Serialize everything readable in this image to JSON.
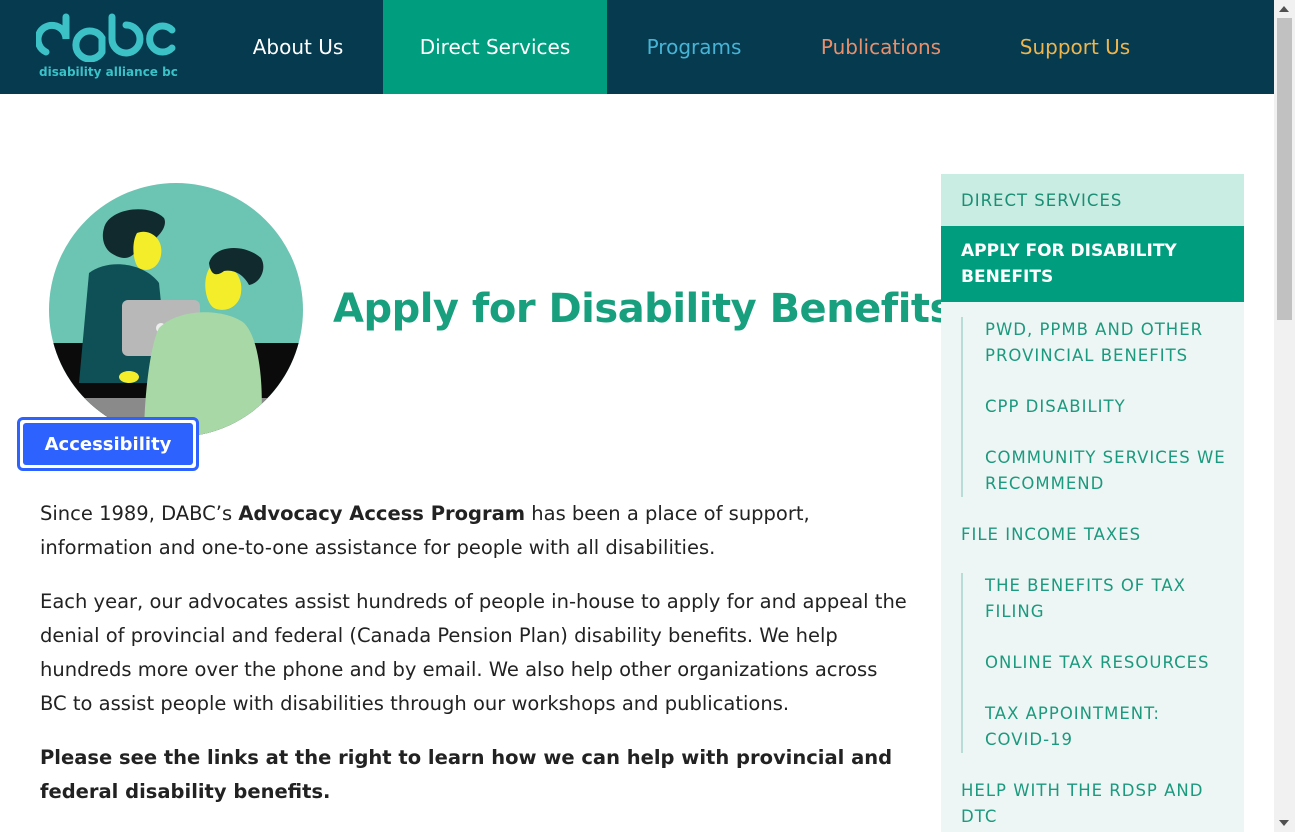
{
  "header": {
    "logo_text": "dabc",
    "logo_subtext": "disability alliance bc",
    "nav": [
      {
        "label": "About Us"
      },
      {
        "label": "Direct Services"
      },
      {
        "label": "Programs"
      },
      {
        "label": "Publications"
      },
      {
        "label": "Support Us"
      }
    ],
    "active_nav": "Direct Services"
  },
  "hero": {
    "title": "Apply for Disability Benefits"
  },
  "accessibility_button": {
    "label": "Accessibility"
  },
  "content": {
    "p1_before": "Since 1989, DABC’s ",
    "p1_bold": "Advocacy Access Program",
    "p1_after": " has been a place of support, information and one-to-one assistance for people with all disabilities.",
    "p2": "Each year, our advocates assist hundreds of people in-house to apply for and appeal the denial of provincial and federal (Canada Pension Plan) disability benefits. We help hundreds more over the phone and by email. We also help other organizations across BC to assist people with disabilities through our workshops and publications.",
    "p3": "Please see the links at the right to learn how we can help with provincial and federal disability benefits."
  },
  "sidebar": {
    "heading": "DIRECT SERVICES",
    "active": "APPLY FOR DISABILITY BENEFITS",
    "sub1": [
      "PWD, PPMB AND OTHER PROVINCIAL BENEFITS",
      "CPP DISABILITY",
      "COMMUNITY SERVICES WE RECOMMEND"
    ],
    "item2": "FILE INCOME TAXES",
    "sub2": [
      "THE BENEFITS OF TAX FILING",
      "ONLINE TAX RESOURCES",
      "TAX APPOINTMENT: COVID-19"
    ],
    "item3": "HELP WITH THE RDSP AND DTC"
  },
  "colors": {
    "header_bg": "#053a4f",
    "accent_green": "#009d7e",
    "title_green": "#18a07e",
    "programs_blue": "#47b4d6",
    "publications_orange": "#ea8f6b",
    "support_gold": "#efb54d",
    "accessibility_blue": "#2d62ff"
  }
}
